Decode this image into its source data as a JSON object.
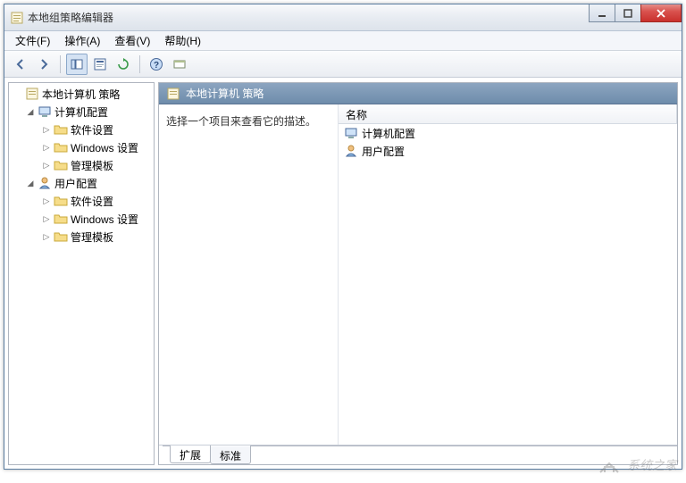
{
  "window": {
    "title": "本地组策略编辑器"
  },
  "menus": {
    "file": "文件(F)",
    "action": "操作(A)",
    "view": "查看(V)",
    "help": "帮助(H)"
  },
  "tree": {
    "root": "本地计算机 策略",
    "computer": "计算机配置",
    "computer_children": {
      "software": "软件设置",
      "windows": "Windows 设置",
      "templates": "管理模板"
    },
    "user": "用户配置",
    "user_children": {
      "software": "软件设置",
      "windows": "Windows 设置",
      "templates": "管理模板"
    }
  },
  "right": {
    "header": "本地计算机 策略",
    "description": "选择一个项目来查看它的描述。",
    "column_name": "名称",
    "items": {
      "computer": "计算机配置",
      "user": "用户配置"
    }
  },
  "tabs": {
    "extended": "扩展",
    "standard": "标准"
  },
  "watermark": "系统之家"
}
